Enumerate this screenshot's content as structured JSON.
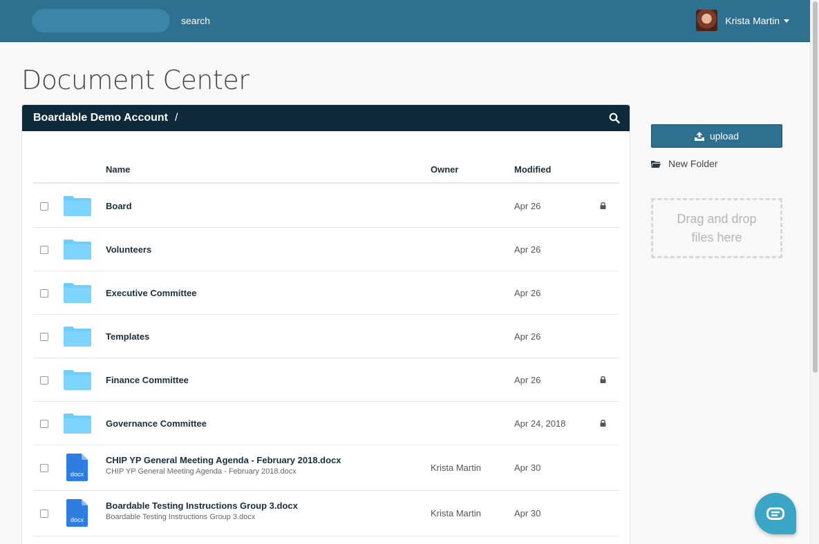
{
  "topbar": {
    "search_label": "search",
    "user_name": "Krista Martin"
  },
  "page": {
    "title": "Document Center"
  },
  "panel": {
    "breadcrumb_root": "Boardable Demo Account",
    "breadcrumb_separator": "/",
    "columns": {
      "name": "Name",
      "owner": "Owner",
      "modified": "Modified"
    },
    "rows": [
      {
        "type": "folder",
        "name": "Board",
        "subname": "",
        "owner": "",
        "modified": "Apr 26",
        "locked": true
      },
      {
        "type": "folder",
        "name": "Volunteers",
        "subname": "",
        "owner": "",
        "modified": "Apr 26",
        "locked": false
      },
      {
        "type": "folder",
        "name": "Executive Committee",
        "subname": "",
        "owner": "",
        "modified": "Apr 26",
        "locked": false
      },
      {
        "type": "folder",
        "name": "Templates",
        "subname": "",
        "owner": "",
        "modified": "Apr 26",
        "locked": false
      },
      {
        "type": "folder",
        "name": "Finance Committee",
        "subname": "",
        "owner": "",
        "modified": "Apr 26",
        "locked": true
      },
      {
        "type": "folder",
        "name": "Governance Committee",
        "subname": "",
        "owner": "",
        "modified": "Apr 24, 2018",
        "locked": true
      },
      {
        "type": "file",
        "ext": "docx",
        "name": "CHIP YP General Meeting Agenda - February 2018.docx",
        "subname": "CHIP YP General Meeting Agenda - February 2018.docx",
        "owner": "Krista Martin",
        "modified": "Apr 30",
        "locked": false
      },
      {
        "type": "file",
        "ext": "docx",
        "name": "Boardable Testing Instructions Group 3.docx",
        "subname": "Boardable Testing Instructions Group 3.docx",
        "owner": "Krista Martin",
        "modified": "Apr 30",
        "locked": false
      }
    ]
  },
  "sidebar": {
    "upload_label": "upload",
    "new_folder_label": "New Folder",
    "dropzone_text": "Drag and drop files here"
  },
  "colors": {
    "topbar": "#2e7090",
    "panel_header": "#0e2a3b",
    "folder": "#6ecdfa",
    "doc": "#2f7de1",
    "chat": "#3aa5c5"
  },
  "icons": {
    "folder": "folder-icon",
    "doc": "docx-file-icon",
    "lock": "lock-icon",
    "search": "search-icon",
    "upload": "upload-icon",
    "chat": "chat-icon"
  }
}
